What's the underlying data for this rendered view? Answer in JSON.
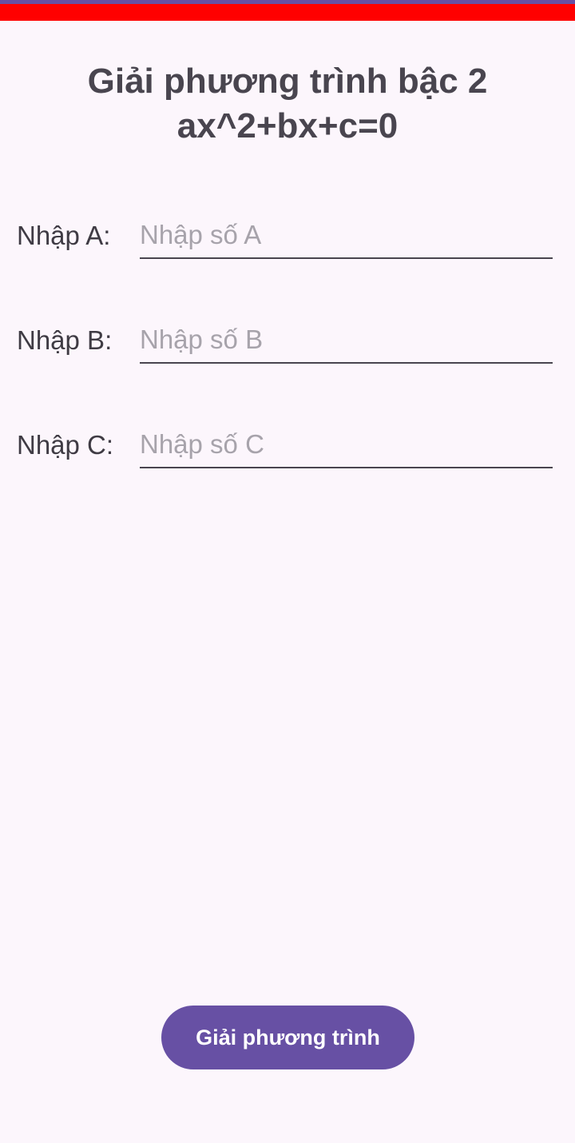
{
  "colors": {
    "status_bar": "#ff0000",
    "status_bar_accent": "#6750a4",
    "background": "#fcf6fc",
    "primary": "#6750a4",
    "text": "#49454f",
    "placeholder": "#a7a3ab"
  },
  "header": {
    "title_line1": "Giải phương trình bậc 2",
    "title_line2": "ax^2+bx+c=0"
  },
  "form": {
    "a": {
      "label": "Nhập A:",
      "placeholder": "Nhập số A",
      "value": ""
    },
    "b": {
      "label": "Nhập B:",
      "placeholder": "Nhập số B",
      "value": ""
    },
    "c": {
      "label": "Nhập C:",
      "placeholder": "Nhập số C",
      "value": ""
    }
  },
  "actions": {
    "solve_label": "Giải phương trình"
  }
}
